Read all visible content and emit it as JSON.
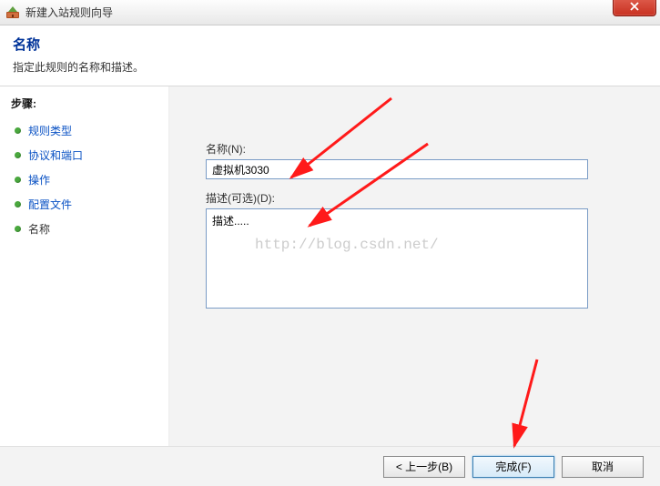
{
  "window": {
    "title": "新建入站规则向导"
  },
  "header": {
    "title": "名称",
    "subtitle": "指定此规则的名称和描述。"
  },
  "sidebar": {
    "title": "步骤:",
    "steps": [
      {
        "label": "规则类型",
        "link": true
      },
      {
        "label": "协议和端口",
        "link": true
      },
      {
        "label": "操作",
        "link": true
      },
      {
        "label": "配置文件",
        "link": true
      },
      {
        "label": "名称",
        "link": false
      }
    ]
  },
  "form": {
    "name_label": "名称(N):",
    "name_value": "虚拟机3030",
    "desc_label": "描述(可选)(D):",
    "desc_value": "描述....."
  },
  "watermark": "http://blog.csdn.net/",
  "footer": {
    "back": "< 上一步(B)",
    "finish": "完成(F)",
    "cancel": "取消"
  }
}
